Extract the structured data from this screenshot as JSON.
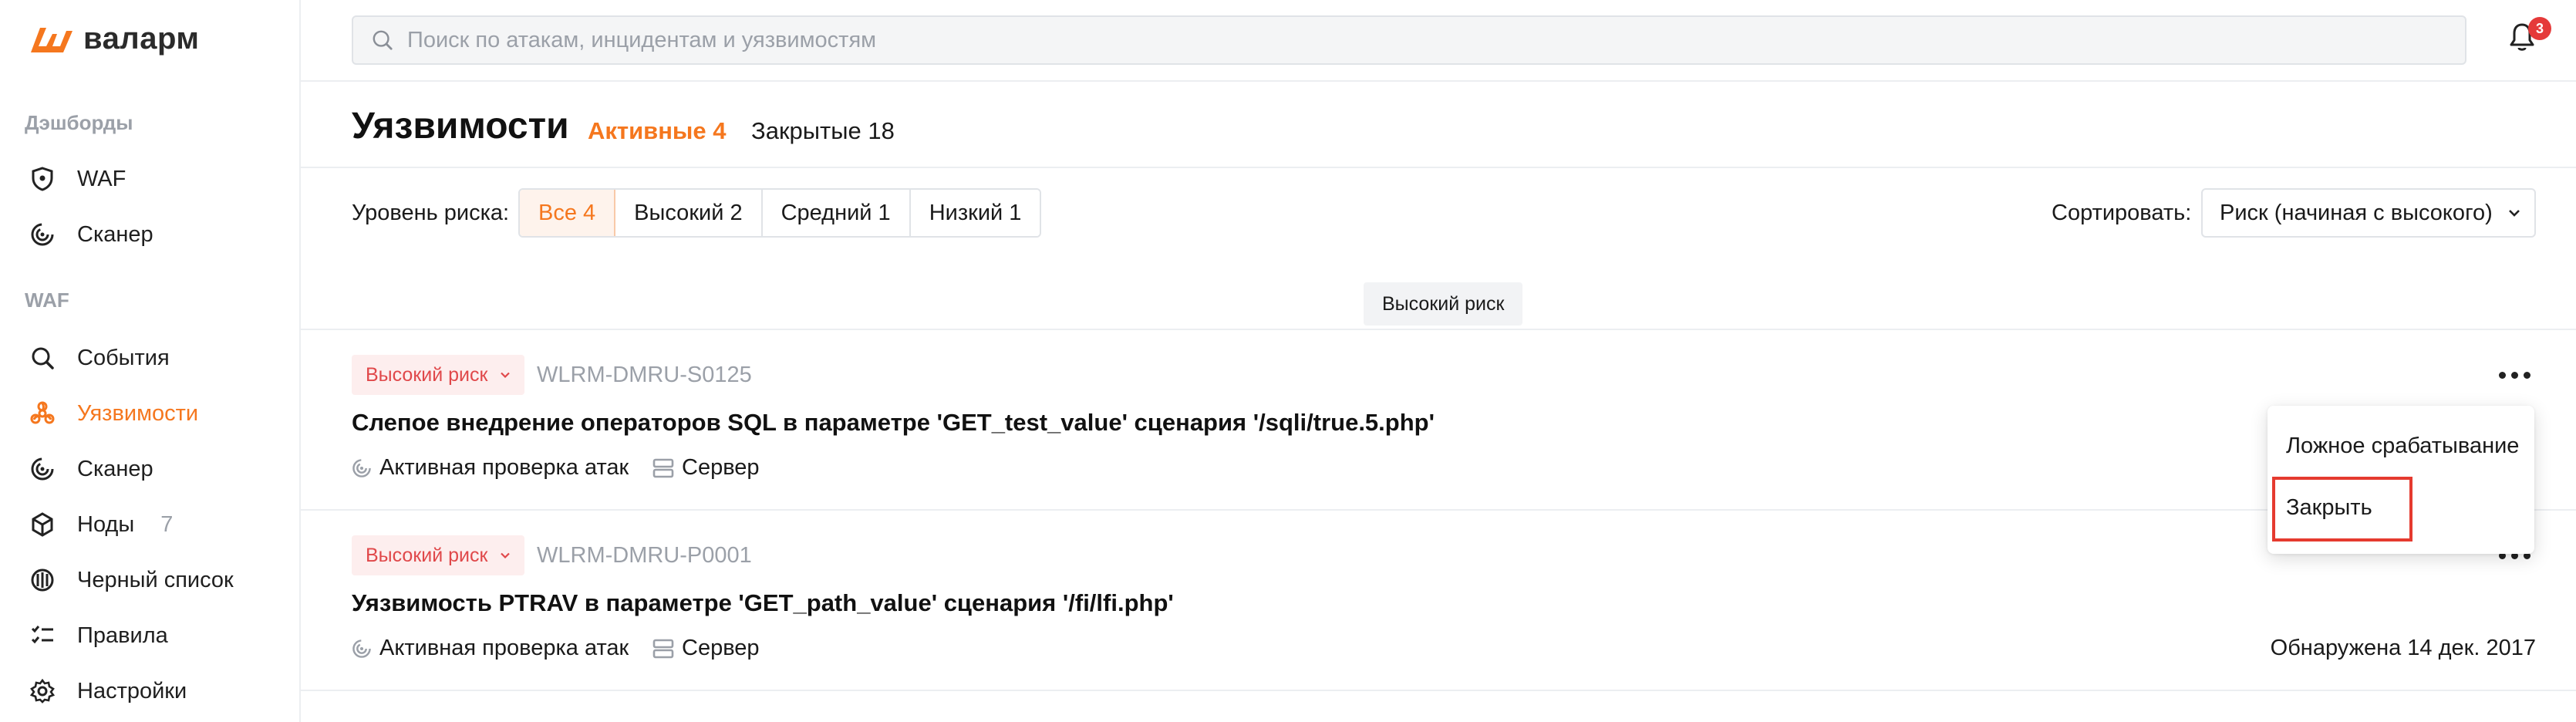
{
  "app": {
    "brand": "валарм",
    "brand_color": "#f5771e"
  },
  "sidebar": {
    "section_dashboards": "Дэшборды",
    "section_waf": "WAF",
    "items": [
      {
        "label": "WAF",
        "icon": "shield-icon"
      },
      {
        "label": "Сканер",
        "icon": "radar-icon"
      },
      {
        "label": "События",
        "icon": "search-icon"
      },
      {
        "label": "Уязвимости",
        "icon": "biohazard-icon",
        "active": true
      },
      {
        "label": "Сканер",
        "icon": "radar-icon"
      },
      {
        "label": "Ноды",
        "count": "7",
        "icon": "node-icon"
      },
      {
        "label": "Черный список",
        "icon": "blocklist-icon"
      },
      {
        "label": "Правила",
        "icon": "rules-icon"
      },
      {
        "label": "Настройки",
        "icon": "gear-icon"
      }
    ]
  },
  "header": {
    "search_placeholder": "Поиск по атакам, инцидентам и уязвимостям",
    "notifications_count": "3"
  },
  "page": {
    "title": "Уязвимости",
    "tab_active": "Активные 4",
    "tab_closed": "Закрытые 18"
  },
  "filters": {
    "risk_label": "Уровень риска:",
    "options": [
      "Все 4",
      "Высокий 2",
      "Средний 1",
      "Низкий 1"
    ],
    "selected": "Все 4",
    "sort_label": "Сортировать:",
    "sort_value": "Риск (начиная с высокого)"
  },
  "group": {
    "label": "Высокий риск"
  },
  "vulns": [
    {
      "risk": "Высокий риск",
      "id": "WLRM-DMRU-S0125",
      "title": "Слепое внедрение операторов SQL в параметре 'GET_test_value' сценария '/sqli/true.5.php'",
      "detection": "Активная проверка атак",
      "target": "Сервер"
    },
    {
      "risk": "Высокий риск",
      "id": "WLRM-DMRU-P0001",
      "title": "Уязвимость PTRAV в параметре 'GET_path_value' сценария '/fi/lfi.php'",
      "detection": "Активная проверка атак",
      "target": "Сервер",
      "found": "Обнаружена 14 дек. 2017"
    }
  ],
  "context_menu": {
    "items": [
      "Ложное срабатывание",
      "Закрыть"
    ],
    "highlight_color": "#e53a2f"
  }
}
